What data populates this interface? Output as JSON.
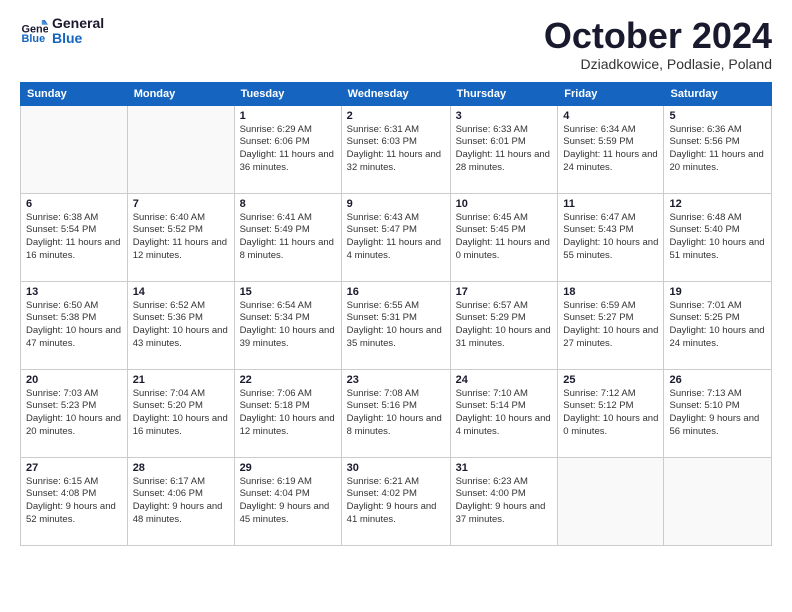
{
  "logo": {
    "line1": "General",
    "line2": "Blue"
  },
  "title": "October 2024",
  "subtitle": "Dziadkowice, Podlasie, Poland",
  "weekdays": [
    "Sunday",
    "Monday",
    "Tuesday",
    "Wednesday",
    "Thursday",
    "Friday",
    "Saturday"
  ],
  "weeks": [
    [
      {
        "day": "",
        "info": ""
      },
      {
        "day": "",
        "info": ""
      },
      {
        "day": "1",
        "info": "Sunrise: 6:29 AM\nSunset: 6:06 PM\nDaylight: 11 hours and 36 minutes."
      },
      {
        "day": "2",
        "info": "Sunrise: 6:31 AM\nSunset: 6:03 PM\nDaylight: 11 hours and 32 minutes."
      },
      {
        "day": "3",
        "info": "Sunrise: 6:33 AM\nSunset: 6:01 PM\nDaylight: 11 hours and 28 minutes."
      },
      {
        "day": "4",
        "info": "Sunrise: 6:34 AM\nSunset: 5:59 PM\nDaylight: 11 hours and 24 minutes."
      },
      {
        "day": "5",
        "info": "Sunrise: 6:36 AM\nSunset: 5:56 PM\nDaylight: 11 hours and 20 minutes."
      }
    ],
    [
      {
        "day": "6",
        "info": "Sunrise: 6:38 AM\nSunset: 5:54 PM\nDaylight: 11 hours and 16 minutes."
      },
      {
        "day": "7",
        "info": "Sunrise: 6:40 AM\nSunset: 5:52 PM\nDaylight: 11 hours and 12 minutes."
      },
      {
        "day": "8",
        "info": "Sunrise: 6:41 AM\nSunset: 5:49 PM\nDaylight: 11 hours and 8 minutes."
      },
      {
        "day": "9",
        "info": "Sunrise: 6:43 AM\nSunset: 5:47 PM\nDaylight: 11 hours and 4 minutes."
      },
      {
        "day": "10",
        "info": "Sunrise: 6:45 AM\nSunset: 5:45 PM\nDaylight: 11 hours and 0 minutes."
      },
      {
        "day": "11",
        "info": "Sunrise: 6:47 AM\nSunset: 5:43 PM\nDaylight: 10 hours and 55 minutes."
      },
      {
        "day": "12",
        "info": "Sunrise: 6:48 AM\nSunset: 5:40 PM\nDaylight: 10 hours and 51 minutes."
      }
    ],
    [
      {
        "day": "13",
        "info": "Sunrise: 6:50 AM\nSunset: 5:38 PM\nDaylight: 10 hours and 47 minutes."
      },
      {
        "day": "14",
        "info": "Sunrise: 6:52 AM\nSunset: 5:36 PM\nDaylight: 10 hours and 43 minutes."
      },
      {
        "day": "15",
        "info": "Sunrise: 6:54 AM\nSunset: 5:34 PM\nDaylight: 10 hours and 39 minutes."
      },
      {
        "day": "16",
        "info": "Sunrise: 6:55 AM\nSunset: 5:31 PM\nDaylight: 10 hours and 35 minutes."
      },
      {
        "day": "17",
        "info": "Sunrise: 6:57 AM\nSunset: 5:29 PM\nDaylight: 10 hours and 31 minutes."
      },
      {
        "day": "18",
        "info": "Sunrise: 6:59 AM\nSunset: 5:27 PM\nDaylight: 10 hours and 27 minutes."
      },
      {
        "day": "19",
        "info": "Sunrise: 7:01 AM\nSunset: 5:25 PM\nDaylight: 10 hours and 24 minutes."
      }
    ],
    [
      {
        "day": "20",
        "info": "Sunrise: 7:03 AM\nSunset: 5:23 PM\nDaylight: 10 hours and 20 minutes."
      },
      {
        "day": "21",
        "info": "Sunrise: 7:04 AM\nSunset: 5:20 PM\nDaylight: 10 hours and 16 minutes."
      },
      {
        "day": "22",
        "info": "Sunrise: 7:06 AM\nSunset: 5:18 PM\nDaylight: 10 hours and 12 minutes."
      },
      {
        "day": "23",
        "info": "Sunrise: 7:08 AM\nSunset: 5:16 PM\nDaylight: 10 hours and 8 minutes."
      },
      {
        "day": "24",
        "info": "Sunrise: 7:10 AM\nSunset: 5:14 PM\nDaylight: 10 hours and 4 minutes."
      },
      {
        "day": "25",
        "info": "Sunrise: 7:12 AM\nSunset: 5:12 PM\nDaylight: 10 hours and 0 minutes."
      },
      {
        "day": "26",
        "info": "Sunrise: 7:13 AM\nSunset: 5:10 PM\nDaylight: 9 hours and 56 minutes."
      }
    ],
    [
      {
        "day": "27",
        "info": "Sunrise: 6:15 AM\nSunset: 4:08 PM\nDaylight: 9 hours and 52 minutes."
      },
      {
        "day": "28",
        "info": "Sunrise: 6:17 AM\nSunset: 4:06 PM\nDaylight: 9 hours and 48 minutes."
      },
      {
        "day": "29",
        "info": "Sunrise: 6:19 AM\nSunset: 4:04 PM\nDaylight: 9 hours and 45 minutes."
      },
      {
        "day": "30",
        "info": "Sunrise: 6:21 AM\nSunset: 4:02 PM\nDaylight: 9 hours and 41 minutes."
      },
      {
        "day": "31",
        "info": "Sunrise: 6:23 AM\nSunset: 4:00 PM\nDaylight: 9 hours and 37 minutes."
      },
      {
        "day": "",
        "info": ""
      },
      {
        "day": "",
        "info": ""
      }
    ]
  ]
}
